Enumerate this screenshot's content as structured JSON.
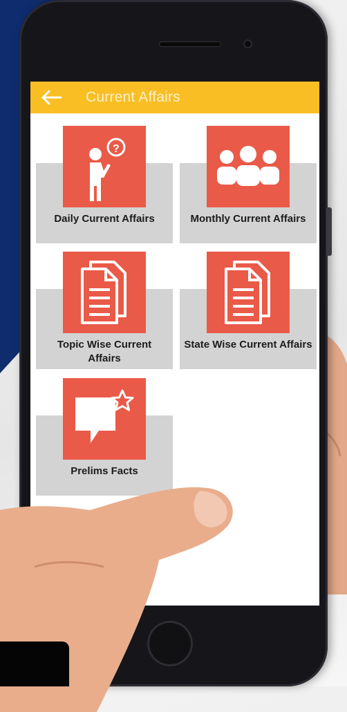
{
  "app": {
    "title": "Current Affairs"
  },
  "colors": {
    "appbar": "#f8be24",
    "tile_icon_bg": "#ea5a48",
    "tile_card_bg": "#d3d3d3",
    "navy_background": "#0f2c6e"
  },
  "tiles": [
    {
      "label": "Daily Current Affairs",
      "icon": "thinking-person-icon"
    },
    {
      "label": "Monthly Current Affairs",
      "icon": "group-people-icon"
    },
    {
      "label": "Topic Wise Current Affairs",
      "icon": "documents-icon"
    },
    {
      "label": "State Wise Current Affairs",
      "icon": "documents-icon"
    },
    {
      "label": "Prelims Facts",
      "icon": "speech-bubble-star-icon"
    }
  ]
}
